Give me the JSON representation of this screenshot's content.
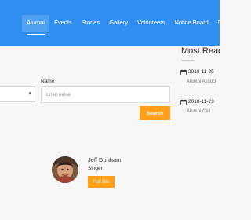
{
  "nav": {
    "items": [
      {
        "label": "Alumni",
        "active": true
      },
      {
        "label": "Events",
        "active": false
      },
      {
        "label": "Stories",
        "active": false
      },
      {
        "label": "Gallery",
        "active": false
      },
      {
        "label": "Volunteers",
        "active": false
      },
      {
        "label": "Notice Board",
        "active": false
      },
      {
        "label": "Donation",
        "active": false
      }
    ]
  },
  "search": {
    "dropdown_value": "",
    "name_label": "Name",
    "name_placeholder": "Enter name",
    "button_label": "Search"
  },
  "profile": {
    "name": "Jeff Dunham",
    "role": "Singer",
    "button_label": "Full Bio"
  },
  "sidebar": {
    "title": "Most Read",
    "events": [
      {
        "date": "2018-11-25",
        "title": "Alumni Associ"
      },
      {
        "date": "2018-11-23",
        "title": "Alumni Cell"
      }
    ]
  },
  "colors": {
    "navbar": "#2f8ef0",
    "button": "#ff9f1a",
    "background": "#f7f7f7"
  },
  "icons": {
    "calendar": "calendar-icon",
    "dropdown": "chevron-down-icon"
  }
}
